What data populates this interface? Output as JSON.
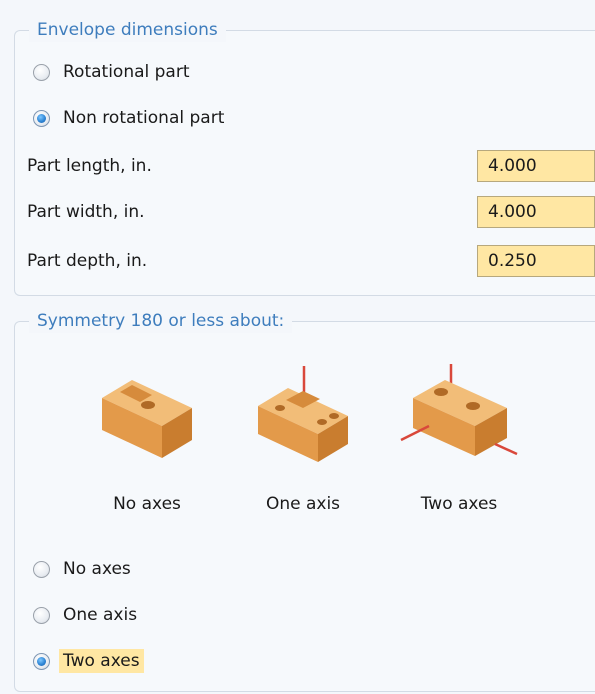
{
  "envelope": {
    "legend": "Envelope dimensions",
    "options": [
      {
        "label": "Rotational part",
        "checked": false
      },
      {
        "label": "Non rotational part",
        "checked": true
      }
    ],
    "fields": [
      {
        "label": "Part length, in.",
        "value": "4.000"
      },
      {
        "label": "Part width, in.",
        "value": "4.000"
      },
      {
        "label": "Part depth, in.",
        "value": "0.250"
      }
    ]
  },
  "symmetry": {
    "legend": "Symmetry 180 or less about:",
    "illustrations": [
      {
        "caption": "No axes",
        "icon": "block-no-axes-icon"
      },
      {
        "caption": "One axis",
        "icon": "block-one-axis-icon"
      },
      {
        "caption": "Two axes",
        "icon": "block-two-axes-icon"
      }
    ],
    "options": [
      {
        "label": "No axes",
        "checked": false
      },
      {
        "label": "One axis",
        "checked": false
      },
      {
        "label": "Two axes",
        "checked": true
      }
    ]
  },
  "colors": {
    "legend_text": "#3e7dbd",
    "input_fill": "#ffe7a3",
    "part_fill": "#e9a65a",
    "axis_line": "#d9483b"
  }
}
